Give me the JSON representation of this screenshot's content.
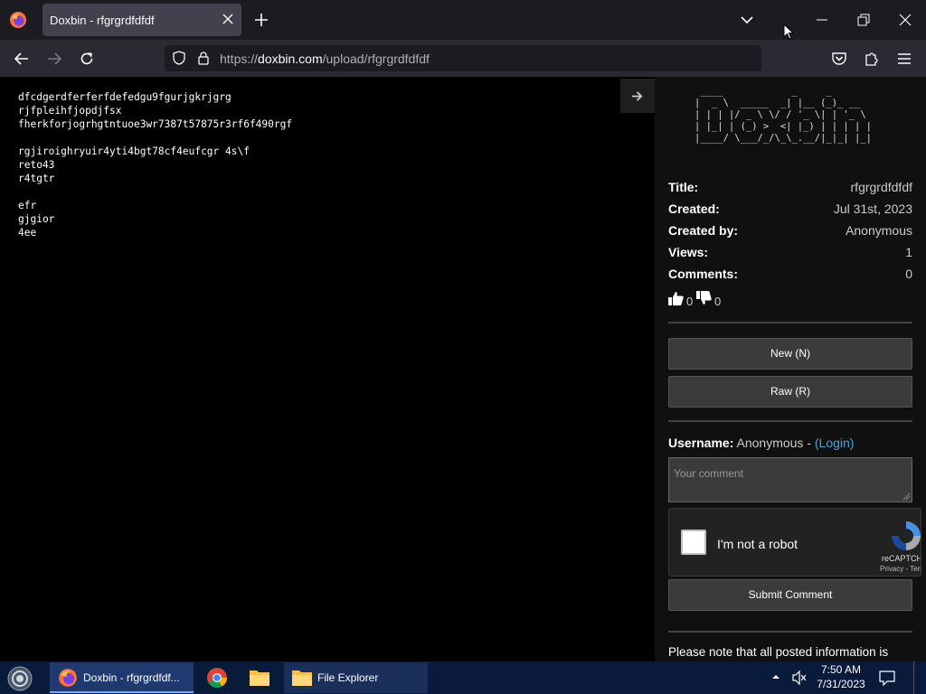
{
  "browser": {
    "tab_title": "Doxbin - rfgrgrdfdfdf",
    "url_prefix": "https://",
    "url_host": "doxbin.com",
    "url_path": "/upload/rfgrgrdfdfdf"
  },
  "paste": {
    "content": "dfcdgerdferferfdefedgu9fgurjgkrjgrg\nrjfpleihfjopdjfsx\nfherkforjogrhgtntuoe3wr7387t57875r3rf6f490rgf\n\nrgjiroighryuir4yti4bgt78cf4eufcgr 4s\\f\nreto43\nr4tgtr\n\nefr\ngjgior\n4ee"
  },
  "sidebar": {
    "logo_ascii": " ____            _     _       \n|  _ \\  _____  _| |__ (_)_ __  \n| | | |/ _ \\ \\/ / '_ \\| | '_ \\ \n| |_| | (_) >  <| |_) | | | | |\n|____/ \\___/_/\\_\\_.__/|_|_| |_|",
    "title_label": "Title:",
    "title_value": "rfgrgrdfdfdf",
    "created_label": "Created:",
    "created_value": "Jul 31st, 2023",
    "created_by_label": "Created by:",
    "created_by_value": "Anonymous",
    "views_label": "Views:",
    "views_value": "1",
    "comments_label": "Comments:",
    "comments_value": "0",
    "likes": "0",
    "dislikes": "0",
    "new_button": "New (N)",
    "raw_button": "Raw (R)",
    "username_label": "Username:",
    "username_value": "Anonymous - ",
    "login_link": "(Login)",
    "comment_placeholder": "Your comment",
    "captcha_label": "I'm not a robot",
    "captcha_brand": "reCAPTCHA",
    "captcha_privacy": "Privacy - Terms",
    "submit_button": "Submit Comment",
    "note": "Please note that all posted information is"
  },
  "taskbar": {
    "firefox_label": "Doxbin - rfgrgrdfdf...",
    "explorer_label": "File Explorer",
    "time": "7:50 AM",
    "date": "7/31/2023"
  },
  "colors": {
    "tab_active": "#42414d",
    "nav_bg": "#2b2a33",
    "link": "#4aa3d8",
    "taskbar_bg": "#0a1a3a"
  }
}
